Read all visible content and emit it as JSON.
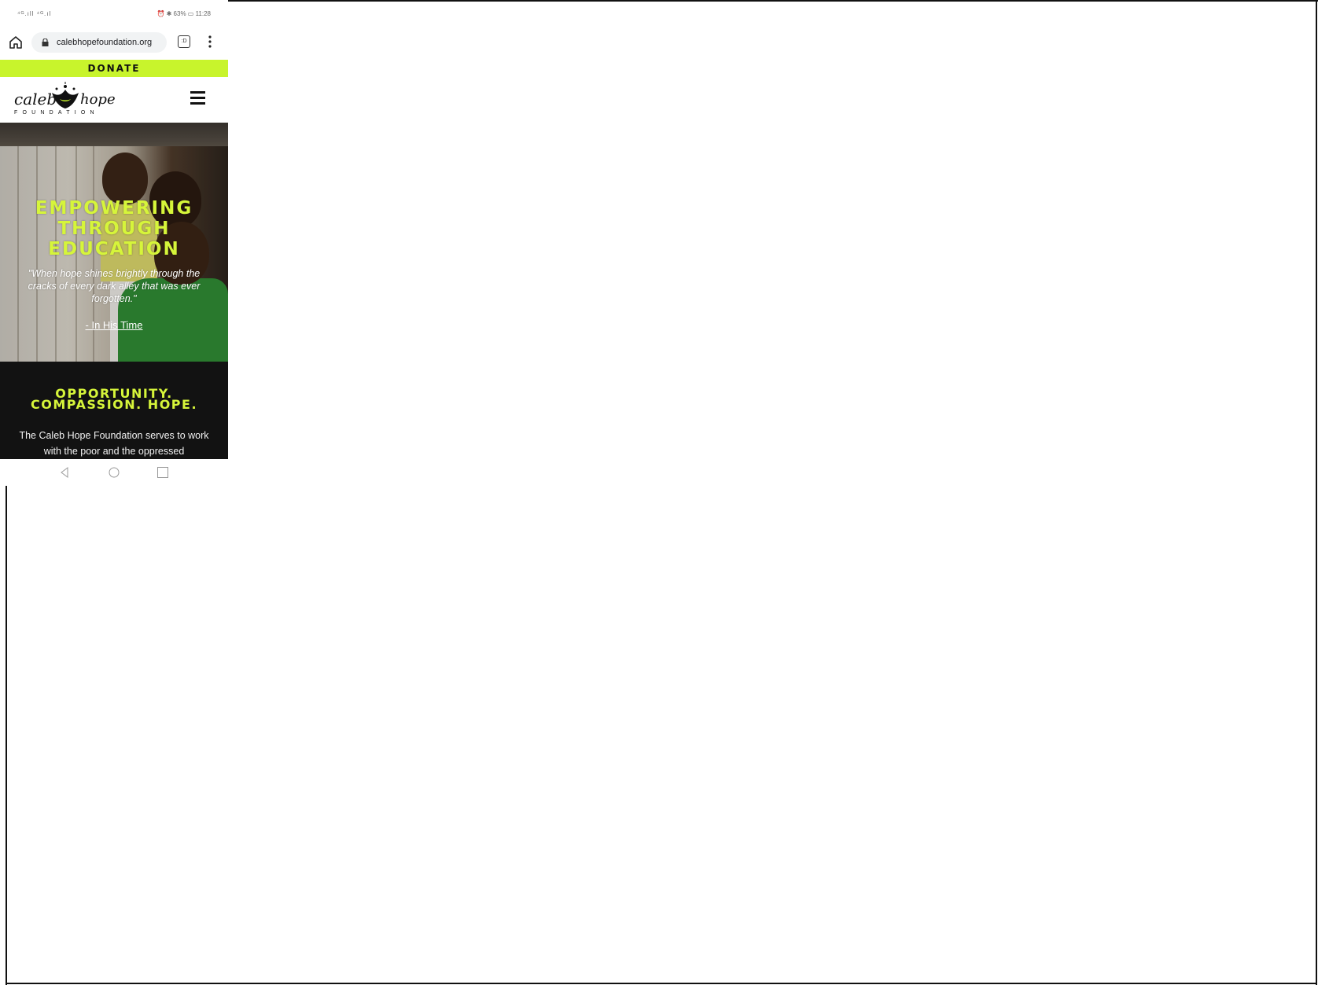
{
  "status_bar": {
    "left_text": "⁴ᴳ.ıll ⁴ᴳ.ıl",
    "right_text": "⏰ ✱ 63% ▭ 11:28"
  },
  "browser": {
    "url": "calebhopefoundation.org",
    "tab_count": ":D"
  },
  "donate": {
    "label": "DONATE",
    "color": "#c8f42c"
  },
  "logo": {
    "word_left": "caleb",
    "word_right": "hope",
    "subtitle": "FOUNDATION"
  },
  "hero": {
    "title_line1": "EMPOWERING",
    "title_line2": "THROUGH",
    "title_line3": "EDUCATION",
    "quote": "\"When hope shines brightly through the cracks of every dark alley that was ever forgotten.\"",
    "source_link": "- In His Time",
    "accent": "#d6f53a"
  },
  "mission": {
    "heading_line1": "OPPORTUNITY.",
    "heading_line2": "COMPASSION. HOPE.",
    "text": "The Caleb Hope Foundation serves to work with the poor and the oppressed"
  }
}
